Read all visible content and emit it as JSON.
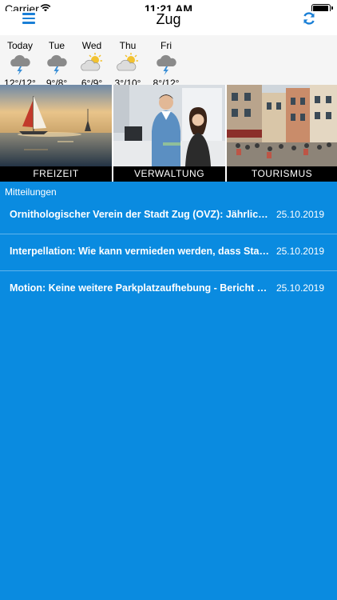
{
  "status_bar": {
    "carrier": "Carrier",
    "time": "11:21 AM"
  },
  "nav": {
    "title": "Zug",
    "menu_icon": "hamburger-menu-icon",
    "refresh_icon": "refresh-icon",
    "accent_color": "#1a7fd6"
  },
  "weather": [
    {
      "day": "Today",
      "temp": "12°/12°",
      "icon": "rain-cloud-icon"
    },
    {
      "day": "Tue",
      "temp": "9°/8°",
      "icon": "rain-cloud-icon"
    },
    {
      "day": "Wed",
      "temp": "6°/9°",
      "icon": "sun-cloud-icon"
    },
    {
      "day": "Thu",
      "temp": "3°/10°",
      "icon": "sun-cloud-icon"
    },
    {
      "day": "Fri",
      "temp": "8°/12°",
      "icon": "rain-cloud-icon"
    }
  ],
  "tiles": [
    {
      "label": "FREIZEIT"
    },
    {
      "label": "VERWALTUNG"
    },
    {
      "label": "TOURISMUS"
    }
  ],
  "news": {
    "heading": "Mitteilungen",
    "background_color": "#0a8be0",
    "items": [
      {
        "title": "Ornithologischer Verein der Stadt Zug (OVZ): Jährliche Generalversammlung",
        "date": "25.10.2019"
      },
      {
        "title": "Interpellation: Wie kann vermieden werden, dass Stadtzuger Einwohner",
        "date": "25.10.2019"
      },
      {
        "title": "Motion: Keine weitere Parkplatzaufhebung - Bericht und Antrag",
        "date": "25.10.2019"
      }
    ]
  }
}
